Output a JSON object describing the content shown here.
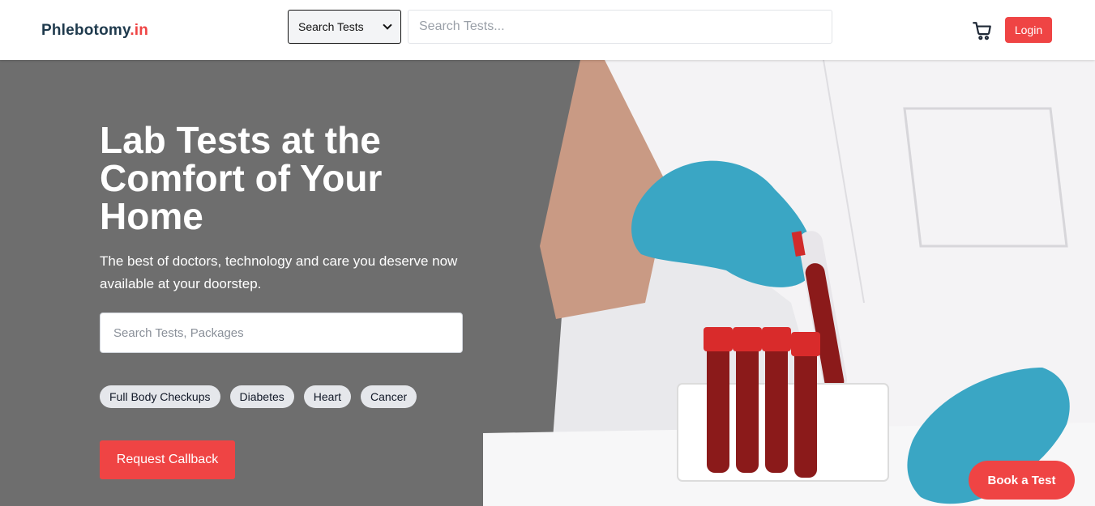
{
  "header": {
    "logo_main": "Phlebotomy",
    "logo_tld": ".in",
    "select_value": "Search Tests",
    "search_placeholder": "Search Tests...",
    "cart_icon": "cart-icon",
    "login_label": "Login"
  },
  "hero": {
    "title": "Lab Tests at the Comfort of Your Home",
    "subtitle": "The best of doctors, technology and care you deserve now available at your doorstep.",
    "search_placeholder": "Search Tests, Packages",
    "chips": [
      "Full Body Checkups",
      "Diabetes",
      "Heart",
      "Cancer"
    ],
    "cta_label": "Request Callback"
  },
  "fab_label": "Book a Test",
  "colors": {
    "accent": "#ef4444",
    "hero_bg": "#6e6e6e",
    "logo_dark": "#1f3a4d"
  }
}
